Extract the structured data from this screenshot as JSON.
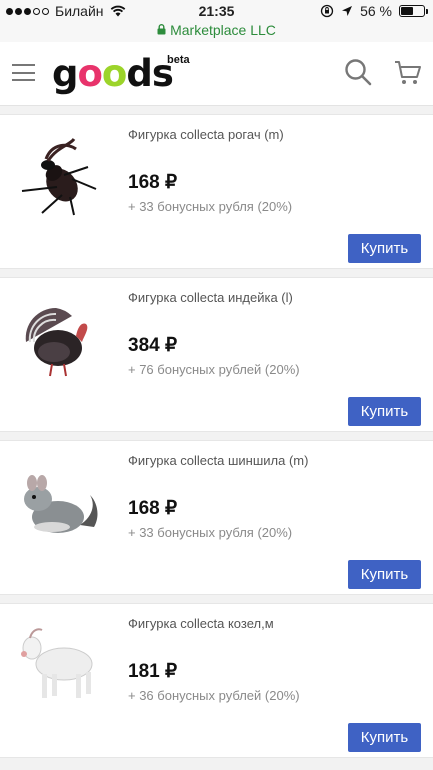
{
  "status": {
    "carrier": "Билайн",
    "time": "21:35",
    "battery": "56 %",
    "battery_level": 0.56
  },
  "browser": {
    "url": "Marketplace LLC"
  },
  "header": {
    "logo_g": "g",
    "logo_ds": "ds",
    "logo_badge": "beta"
  },
  "products": [
    {
      "title": "Фигурка collecta рогач (m)",
      "price": "168 ₽",
      "bonus": "+ 33 бонусных рубля (20%)",
      "buy": "Купить",
      "image": "stag-beetle"
    },
    {
      "title": "Фигурка collecta индейка (l)",
      "price": "384 ₽",
      "bonus": "+ 76 бонусных рублей (20%)",
      "buy": "Купить",
      "image": "turkey"
    },
    {
      "title": "Фигурка collecta шиншила (m)",
      "price": "168 ₽",
      "bonus": "+ 33 бонусных рубля (20%)",
      "buy": "Купить",
      "image": "chinchilla"
    },
    {
      "title": "Фигурка collecta козел,м",
      "price": "181 ₽",
      "bonus": "+ 36 бонусных рублей (20%)",
      "buy": "Купить",
      "image": "goat"
    }
  ],
  "colors": {
    "accent": "#3f62c4",
    "logo_pink": "#e8336b",
    "logo_green": "#9cd42a",
    "secure": "#2d8c3c"
  }
}
